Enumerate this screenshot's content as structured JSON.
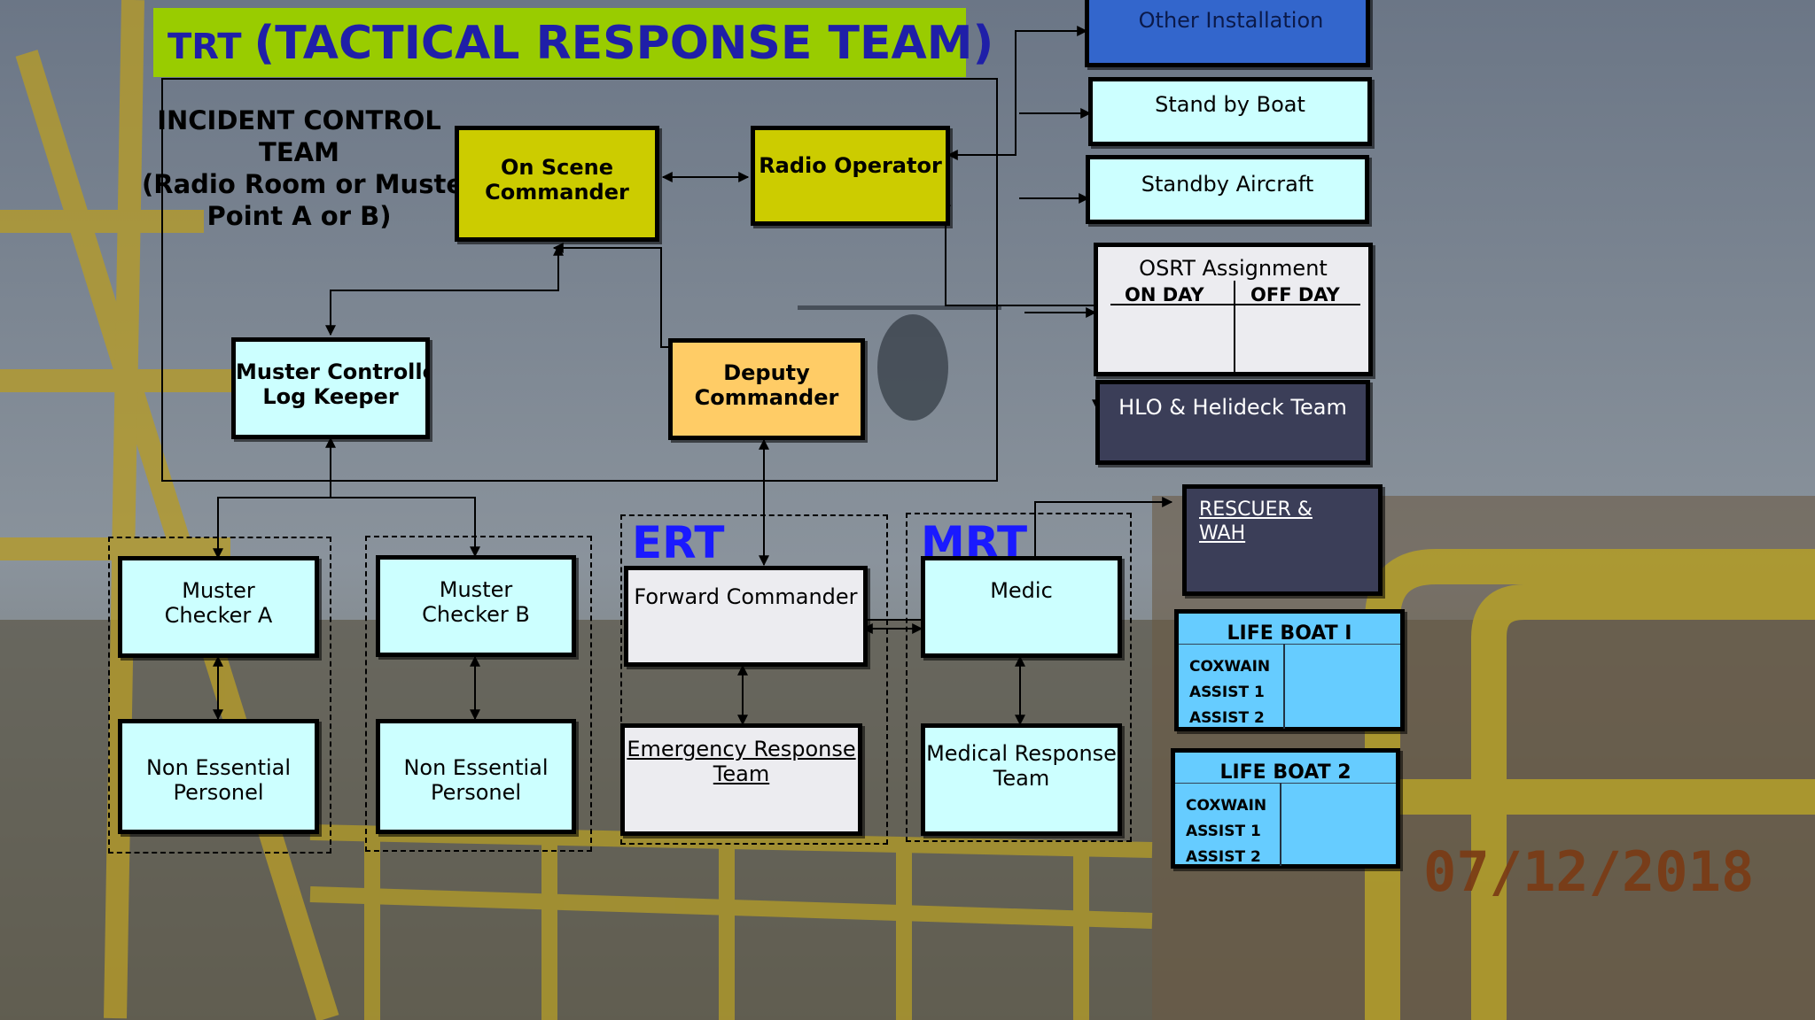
{
  "title": {
    "prefix": "TRT ",
    "main": "(TACTICAL RESPONSE TEAM)"
  },
  "incident_control": {
    "line1": "INCIDENT CONTROL",
    "line2": "TEAM",
    "line3": "(Radio Room or Muster",
    "line4": "Point A or B)"
  },
  "boxes": {
    "on_scene": [
      "On Scene",
      "Commander"
    ],
    "radio": "Radio Operator",
    "muster_controller": [
      "Muster Controller /",
      "Log Keeper"
    ],
    "deputy": [
      "Deputy",
      "Commander"
    ],
    "other_installation": "Other Installation",
    "standby_boat": "Stand by Boat",
    "standby_aircraft": "Standby Aircraft",
    "hlo": "HLO & Helideck Team",
    "rescuer": [
      "RESCUER  & ",
      "WAH "
    ],
    "muster_a": [
      "Muster",
      "Checker A"
    ],
    "muster_b": [
      "Muster",
      "Checker B"
    ],
    "non_essential_a": [
      "Non Essential",
      "Personel"
    ],
    "non_essential_b": [
      "Non Essential",
      "Personel"
    ],
    "forward_commander": "Forward Commander",
    "ert_team": [
      "Emergency Response ",
      "Team"
    ],
    "medic": "Medic",
    "medical_team": [
      "Medical Response",
      "Team"
    ]
  },
  "osrt": {
    "title": "OSRT  Assignment",
    "col1": "ON DAY",
    "col2": "OFF DAY"
  },
  "groups": {
    "ert": "ERT",
    "mrt": "MRT"
  },
  "lifeboats": [
    {
      "title": "LIFE BOAT I",
      "roles": [
        "COXWAIN",
        "ASSIST 1",
        "ASSIST 2"
      ]
    },
    {
      "title": "LIFE BOAT 2",
      "roles": [
        "COXWAIN",
        "ASSIST 1",
        "ASSIST 2"
      ]
    }
  ],
  "date_stamp": "07/12/2018",
  "colors": {
    "title_bar": "#99cc00",
    "title_text": "#1f1fa8",
    "group_label": "#1a1aff",
    "date_stamp": "#7a3a14"
  }
}
